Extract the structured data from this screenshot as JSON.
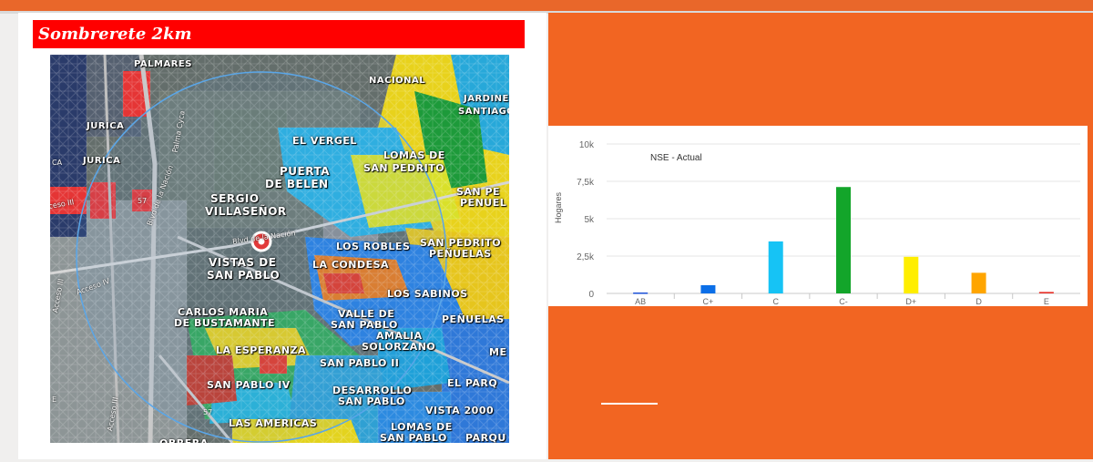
{
  "map_title": "Sombrerete 2km",
  "map": {
    "area_labels": [
      {
        "id": "palmares",
        "text": "PALMARES",
        "size": 10
      },
      {
        "id": "nacional",
        "text": "NACIONAL",
        "size": 10
      },
      {
        "id": "jardines",
        "text": "JARDINES",
        "size": 10
      },
      {
        "id": "santiago",
        "text": "SANTIAGO",
        "size": 10
      },
      {
        "id": "jurica-1",
        "text": "JURICA",
        "size": 10
      },
      {
        "id": "jurica-2",
        "text": "JURICA",
        "size": 10
      },
      {
        "id": "el-vergel",
        "text": "EL VERGEL",
        "size": 11
      },
      {
        "id": "lomas-de",
        "text": "LOMAS DE",
        "size": 11
      },
      {
        "id": "san-pedrito",
        "text": "SAN PEDRITO",
        "size": 11
      },
      {
        "id": "puerta",
        "text": "PUERTA",
        "size": 12
      },
      {
        "id": "de-belen",
        "text": "DE BELEN",
        "size": 12
      },
      {
        "id": "san-pedrito-penuelas-1",
        "text": "SAN PE",
        "size": 11
      },
      {
        "id": "penuel",
        "text": "PENUEL",
        "size": 11
      },
      {
        "id": "sergio",
        "text": "Sergio",
        "size": 12
      },
      {
        "id": "villasenor",
        "text": "Villaseñor",
        "size": 12
      },
      {
        "id": "los-robles",
        "text": "LOS ROBLES",
        "size": 11
      },
      {
        "id": "san-pedrito-2",
        "text": "SAN PEDRITO",
        "size": 11
      },
      {
        "id": "penuelas-2",
        "text": "PEÑUELAS",
        "size": 11
      },
      {
        "id": "vistas-de",
        "text": "Vistas De",
        "size": 12
      },
      {
        "id": "san-pablo-1",
        "text": "San Pablo",
        "size": 12
      },
      {
        "id": "la-condesa",
        "text": "LA CONDESA",
        "size": 11
      },
      {
        "id": "los-sabinos",
        "text": "LOS SABINOS",
        "size": 11
      },
      {
        "id": "carlos-maria",
        "text": "CARLOS MARIA",
        "size": 11
      },
      {
        "id": "de-bustamante",
        "text": "DE BUSTAMANTE",
        "size": 11
      },
      {
        "id": "valle-de",
        "text": "VALLE DE",
        "size": 11
      },
      {
        "id": "san-pablo-2",
        "text": "SAN PABLO",
        "size": 11
      },
      {
        "id": "penuelas-3",
        "text": "PEÑUELAS",
        "size": 11
      },
      {
        "id": "amalia",
        "text": "AMALIA",
        "size": 11
      },
      {
        "id": "solorzano",
        "text": "SOLORZANO",
        "size": 11
      },
      {
        "id": "la-esperanza",
        "text": "LA ESPERANZA",
        "size": 11
      },
      {
        "id": "me",
        "text": "ME",
        "size": 11
      },
      {
        "id": "san-pablo-ii",
        "text": "SAN PABLO II",
        "size": 11
      },
      {
        "id": "san-pablo-iv",
        "text": "SAN PABLO IV",
        "size": 11
      },
      {
        "id": "desarrollo",
        "text": "DESARROLLO",
        "size": 11
      },
      {
        "id": "san-pablo-3",
        "text": "SAN PABLO",
        "size": 11
      },
      {
        "id": "el-parq",
        "text": "EL PARQ",
        "size": 11
      },
      {
        "id": "vista-2000",
        "text": "VISTA 2000",
        "size": 11
      },
      {
        "id": "las-americas",
        "text": "LAS AMERICAS",
        "size": 11
      },
      {
        "id": "lomas-de-2",
        "text": "LOMAS DE",
        "size": 11
      },
      {
        "id": "san-pablo-4",
        "text": "SAN PABLO",
        "size": 11
      },
      {
        "id": "parqu",
        "text": "PARQU",
        "size": 11
      },
      {
        "id": "obrera",
        "text": "OBRERA",
        "size": 11
      }
    ],
    "road_labels": [
      {
        "id": "palma-cyca",
        "text": "Palma Cyca"
      },
      {
        "id": "blvd-nacion-1",
        "text": "Blvd de la Nación"
      },
      {
        "id": "blvd-nacion-2",
        "text": "Blvd de la Nación"
      },
      {
        "id": "acceso-iii-1",
        "text": "Acceso III"
      },
      {
        "id": "acceso-iv",
        "text": "Acceso IV"
      },
      {
        "id": "acceso-iii-2",
        "text": "Acceso III"
      },
      {
        "id": "acceso-top",
        "text": "cceso III"
      },
      {
        "id": "route-57-1",
        "text": "57"
      },
      {
        "id": "route-57-2",
        "text": "57"
      },
      {
        "id": "left-e",
        "text": "E"
      },
      {
        "id": "left-ca",
        "text": "CA"
      }
    ]
  },
  "chart_data": {
    "type": "bar",
    "title": "NSE - Actual",
    "ylabel": "Hogares",
    "xlabel": "",
    "categories": [
      "AB",
      "C+",
      "C",
      "C-",
      "D+",
      "D",
      "E"
    ],
    "values": [
      60,
      550,
      3480,
      7120,
      2450,
      1380,
      100
    ],
    "colors": [
      "#1a4fd6",
      "#0b6fe8",
      "#16c3f5",
      "#13a52a",
      "#ffee00",
      "#ffa500",
      "#e8322a"
    ],
    "ylim": [
      0,
      10000
    ],
    "yticks": [
      0,
      2500,
      5000,
      7500,
      10000
    ],
    "ytick_labels": [
      "0",
      "2,5k",
      "5k",
      "7,5k",
      "10k"
    ],
    "grid": true,
    "legend": "none"
  }
}
